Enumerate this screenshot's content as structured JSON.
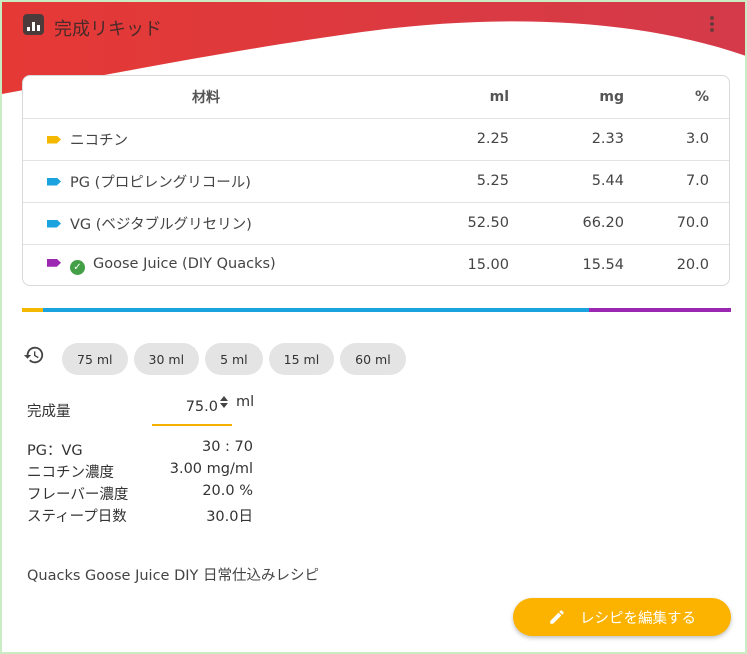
{
  "header": {
    "title": "完成リキッド",
    "app_icon": "bar-chart-icon",
    "menu_icon": "more-vert-icon",
    "gradient_from": "#e53935",
    "gradient_to": "#d43a4a"
  },
  "table": {
    "headers": [
      "材料",
      "ml",
      "mg",
      "%"
    ],
    "rows": [
      {
        "name": "ニコチン",
        "tag_color": "#f5b800",
        "ml": "2.25",
        "mg": "2.33",
        "pct": "3.0"
      },
      {
        "name": "PG (プロピレングリコール)",
        "tag_color": "#1ba3e0",
        "ml": "5.25",
        "mg": "5.44",
        "pct": "7.0"
      },
      {
        "name": "VG (ベジタブルグリセリン)",
        "tag_color": "#1ba3e0",
        "ml": "52.50",
        "mg": "66.20",
        "pct": "70.0"
      },
      {
        "name": "Goose Juice (DIY Quacks)",
        "tag_color": "#9c27b0",
        "verified": true,
        "ml": "15.00",
        "mg": "15.54",
        "pct": "20.0"
      }
    ]
  },
  "ratio_bar": [
    {
      "color": "#f5b800",
      "fraction": 0.03
    },
    {
      "color": "#1ba3e0",
      "fraction": 0.77
    },
    {
      "color": "#9c27b0",
      "fraction": 0.2
    }
  ],
  "presets": {
    "icon": "history-icon",
    "chips": [
      "75 ml",
      "30 ml",
      "5 ml",
      "15 ml",
      "60 ml"
    ]
  },
  "amount": {
    "label": "完成量",
    "value": "75.0",
    "unit": "ml"
  },
  "stats": [
    {
      "label": "PG：VG",
      "value": "30 : 70"
    },
    {
      "label": "ニコチン濃度",
      "value": "3.00 mg/ml"
    },
    {
      "label": "フレーバー濃度",
      "value": "20.0 %"
    },
    {
      "label": "スティープ日数",
      "value": "30.0日"
    }
  ],
  "description": "Quacks Goose Juice DIY 日常仕込みレシピ",
  "edit_button": {
    "label": "レシピを編集する",
    "icon": "pencil-icon",
    "color": "#fbb300"
  }
}
